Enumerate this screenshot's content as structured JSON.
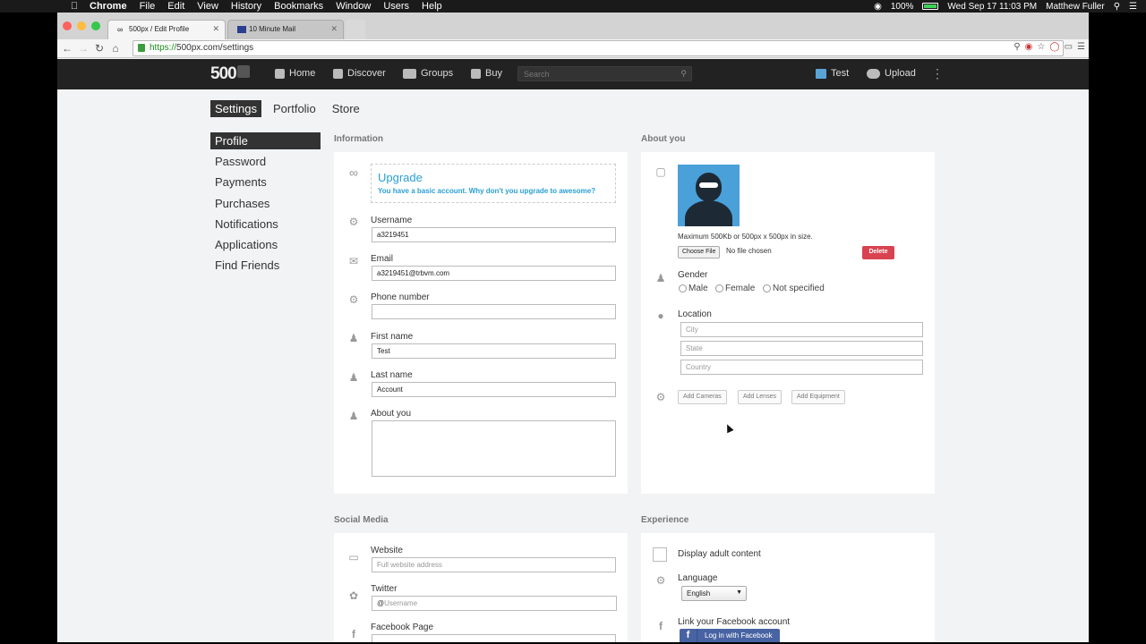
{
  "menubar": {
    "items": [
      "Chrome",
      "File",
      "Edit",
      "View",
      "History",
      "Bookmarks",
      "Window",
      "Users",
      "Help"
    ],
    "battery": "100%",
    "datetime": "Wed Sep 17  11:03 PM",
    "user": "Matthew Fuller"
  },
  "browser": {
    "tabs": [
      {
        "title": "500px / Edit Profile"
      },
      {
        "title": "10 Minute Mail"
      }
    ],
    "url_scheme": "https://",
    "url_rest": "500px.com/settings"
  },
  "header": {
    "logo": "500",
    "nav": [
      "Home",
      "Discover",
      "Groups",
      "Buy"
    ],
    "search_placeholder": "Search",
    "user": "Test",
    "upload": "Upload"
  },
  "subnav": [
    "Settings",
    "Portfolio",
    "Store"
  ],
  "sidebar": [
    "Profile",
    "Password",
    "Payments",
    "Purchases",
    "Notifications",
    "Applications",
    "Find Friends"
  ],
  "information": {
    "label": "Information",
    "upgrade_title": "Upgrade",
    "upgrade_sub": "You have a basic account. Why don't you upgrade to awesome?",
    "username_label": "Username",
    "username": "a3219451",
    "email_label": "Email",
    "email": "a3219451@trbvm.com",
    "phone_label": "Phone number",
    "phone": "",
    "firstname_label": "First name",
    "firstname": "Test",
    "lastname_label": "Last name",
    "lastname": "Account",
    "about_label": "About you"
  },
  "about": {
    "label": "About you",
    "photo_hint": "Maximum 500Kb or 500px x 500px in size.",
    "choose_file": "Choose File",
    "no_file": "No file chosen",
    "delete": "Delete",
    "gender_label": "Gender",
    "gender_options": [
      "Male",
      "Female",
      "Not specified"
    ],
    "location_label": "Location",
    "city_placeholder": "City",
    "state_placeholder": "State",
    "country_placeholder": "Country",
    "add_cameras": "Add Cameras",
    "add_lenses": "Add Lenses",
    "add_equipment": "Add Equipment"
  },
  "social": {
    "label": "Social Media",
    "website_label": "Website",
    "website_placeholder": "Full website address",
    "twitter_label": "Twitter",
    "twitter_placeholder": "Username",
    "facebook_label": "Facebook Page"
  },
  "experience": {
    "label": "Experience",
    "adult_label": "Display adult content",
    "language_label": "Language",
    "language_value": "English",
    "facebook_link_label": "Link your Facebook account",
    "facebook_button": "Log in with Facebook"
  },
  "colors": {
    "accent": "#2b9fd6",
    "delete": "#d94350",
    "facebook": "#4863a3",
    "header_bg": "#222222"
  }
}
